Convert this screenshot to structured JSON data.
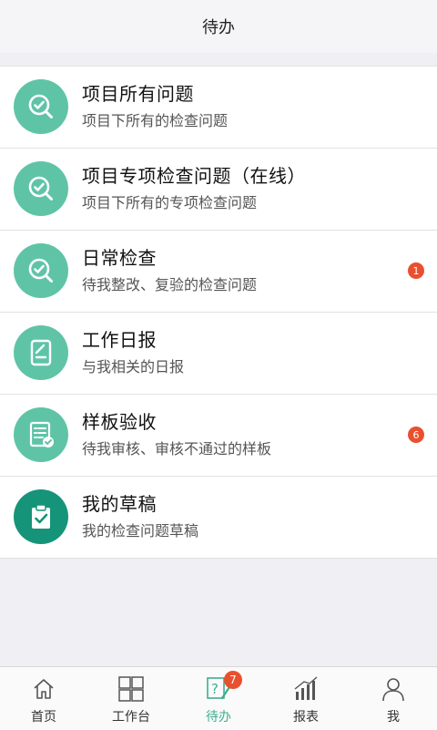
{
  "header": {
    "title": "待办"
  },
  "items": [
    {
      "title": "项目所有问题",
      "subtitle": "项目下所有的检查问题",
      "icon": "inspect-search-icon",
      "badge": ""
    },
    {
      "title": "项目专项检查问题（在线）",
      "subtitle": "项目下所有的专项检查问题",
      "icon": "inspect-search-icon",
      "badge": ""
    },
    {
      "title": "日常检查",
      "subtitle": "待我整改、复验的检查问题",
      "icon": "inspect-search-icon",
      "badge": "1"
    },
    {
      "title": "工作日报",
      "subtitle": "与我相关的日报",
      "icon": "daily-report-icon",
      "badge": ""
    },
    {
      "title": "样板验收",
      "subtitle": "待我审核、审核不通过的样板",
      "icon": "sample-acceptance-icon",
      "badge": "6"
    },
    {
      "title": "我的草稿",
      "subtitle": "我的检查问题草稿",
      "icon": "clipboard-check-icon",
      "badge": ""
    }
  ],
  "tabbar": {
    "home": "首页",
    "workbench": "工作台",
    "todo": "待办",
    "todo_badge": "7",
    "reports": "报表",
    "me": "我"
  },
  "colors": {
    "accent": "#5fc4a6",
    "accent_dark": "#15947a",
    "badge": "#e9502f",
    "active_tab": "#3fae8f"
  }
}
